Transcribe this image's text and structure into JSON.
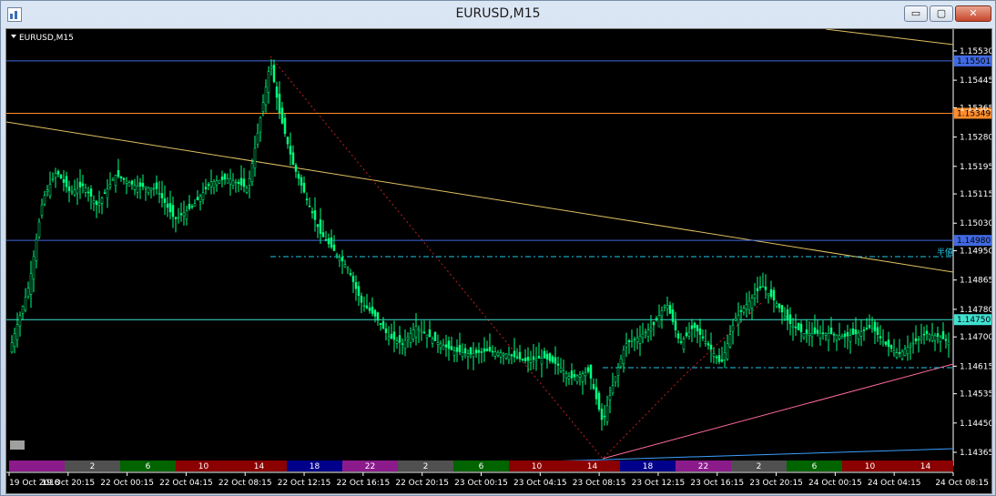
{
  "window": {
    "title": "EURUSD,M15",
    "buttons": {
      "minimize": "▭",
      "maximize": "▢",
      "close": "✕"
    }
  },
  "chart_data": {
    "type": "candlestick",
    "symbol_label": "EURUSD,M15",
    "y_range": [
      1.14365,
      1.1558
    ],
    "y_ticks": [
      "1.15530",
      "1.15445",
      "1.15365",
      "1.15280",
      "1.15195",
      "1.15115",
      "1.15030",
      "1.14950",
      "1.14865",
      "1.14780",
      "1.14700",
      "1.14615",
      "1.14535",
      "1.14450",
      "1.14365"
    ],
    "x_ticks": [
      "19 Oct 2018",
      "19 Oct 20:15",
      "22 Oct 00:15",
      "22 Oct 04:15",
      "22 Oct 08:15",
      "22 Oct 12:15",
      "22 Oct 16:15",
      "22 Oct 20:15",
      "23 Oct 00:15",
      "23 Oct 04:15",
      "23 Oct 08:15",
      "23 Oct 12:15",
      "23 Oct 16:15",
      "23 Oct 20:15",
      "24 Oct 00:15",
      "24 Oct 04:15",
      "24 Oct 08:15"
    ],
    "horizontal_levels": [
      {
        "value": 1.15501,
        "label": "1.15501",
        "color": "#4169e1"
      },
      {
        "value": 1.15349,
        "label": "1.15349",
        "color": "#ff8c2a"
      },
      {
        "value": 1.1498,
        "label": "1.14980",
        "color": "#4169e1"
      },
      {
        "value": 1.1475,
        "label": "1.14750",
        "color": "#40e0d0"
      }
    ],
    "dashed_level_text": "半値",
    "sessions": [
      {
        "label": "",
        "color": "#8b1a8b"
      },
      {
        "label": "2",
        "color": "#505050"
      },
      {
        "label": "6",
        "color": "#006400"
      },
      {
        "label": "10",
        "color": "#8b0000"
      },
      {
        "label": "14",
        "color": "#8b0000"
      },
      {
        "label": "18",
        "color": "#00008b"
      },
      {
        "label": "22",
        "color": "#8b1a8b"
      },
      {
        "label": "2",
        "color": "#505050"
      },
      {
        "label": "6",
        "color": "#006400"
      },
      {
        "label": "10",
        "color": "#8b0000"
      },
      {
        "label": "14",
        "color": "#8b0000"
      },
      {
        "label": "18",
        "color": "#00008b"
      },
      {
        "label": "22",
        "color": "#8b1a8b"
      },
      {
        "label": "2",
        "color": "#505050"
      },
      {
        "label": "6",
        "color": "#006400"
      },
      {
        "label": "10",
        "color": "#8b0000"
      },
      {
        "label": "14",
        "color": "#8b0000"
      }
    ],
    "colors": {
      "up": "#00ff7f",
      "down": "#00ff7f",
      "background": "#000000",
      "axis_text": "#ffffff"
    }
  }
}
